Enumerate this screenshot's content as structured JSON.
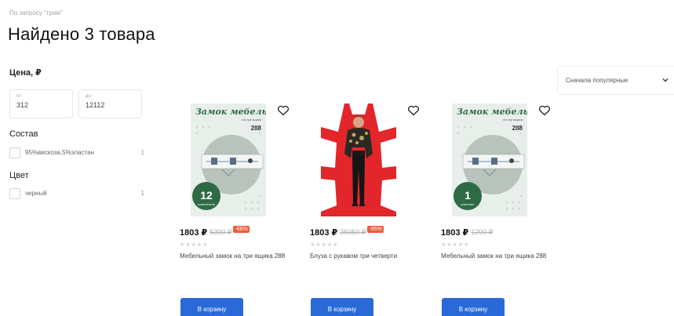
{
  "search": {
    "query_label": "По запросу \"трим\""
  },
  "results": {
    "title": "Найдено 3 товара"
  },
  "filters": {
    "price": {
      "heading": "Цена, ₽",
      "from_label": "от",
      "from_value": "312",
      "to_label": "до",
      "to_value": "12112"
    },
    "composition": {
      "heading": "Состав",
      "items": [
        {
          "label": "95%вискоза,5%эластан",
          "count": "1"
        }
      ]
    },
    "color": {
      "heading": "Цвет",
      "items": [
        {
          "label": "черный",
          "count": "1"
        }
      ]
    }
  },
  "sort": {
    "selected": "Сначала популярные",
    "icon": "chevron-down-icon"
  },
  "products": [
    {
      "price": "1803 ₽",
      "old_price": "5300 ₽",
      "discount": "-66%",
      "name": "Мебельный замок на три ящика 288",
      "button": "В корзину",
      "image_title": "Замок мебельный",
      "image_subtitle": "на три ящика",
      "image_code": "288",
      "badge_number": "12",
      "badge_text": "комплектов"
    },
    {
      "price": "1803 ₽",
      "old_price": "36050 ₽",
      "discount": "-95%",
      "name": "Блуза с рукавом три четверти",
      "button": "В корзину"
    },
    {
      "price": "1803 ₽",
      "old_price": "1200 ₽",
      "name": "Мебельный замок на три ящика 288",
      "button": "В корзину",
      "image_title": "Замок мебельный",
      "image_subtitle": "на три ящика",
      "image_code": "288",
      "badge_number": "1",
      "badge_text": "комплект"
    }
  ],
  "colors": {
    "accent": "#2a6ad8",
    "discount": "#f05a3c",
    "badge_green": "#2e6b45",
    "photo_red": "#e3262b"
  }
}
